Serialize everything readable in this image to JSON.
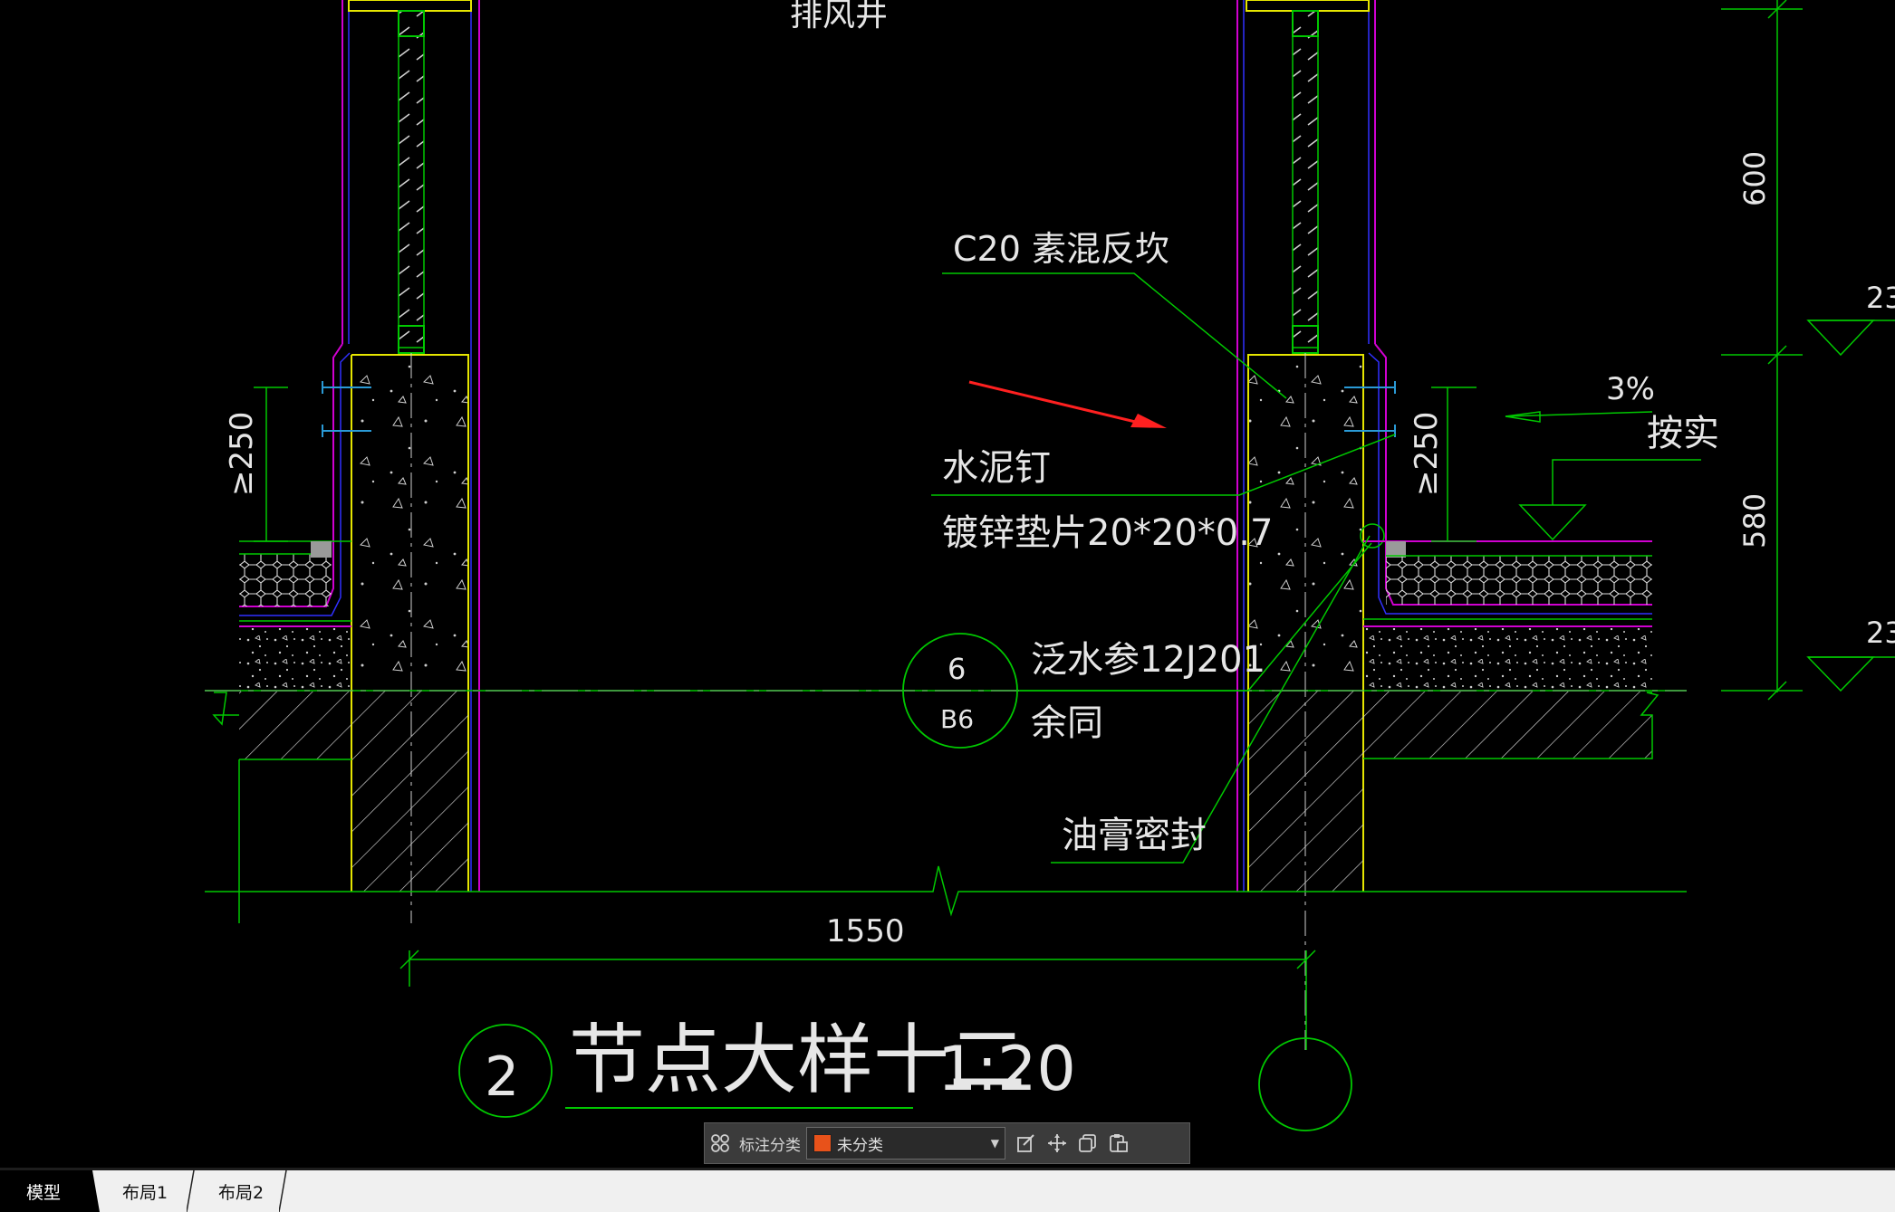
{
  "drawing": {
    "title_top": "排风井",
    "dim_600": "600",
    "dim_580": "580",
    "elev_mark_top": "23",
    "elev_mark_bottom": "23",
    "dim_250_left": "≥250",
    "dim_250_right": "≥250",
    "slope": "3%",
    "slope_note": "按实",
    "label_c20": "C20  素混反坎",
    "label_nail": "水泥钉",
    "label_washer": "镀锌垫片20*20*0.7",
    "label_flashing": "泛水参12J201",
    "label_same": "余同",
    "label_seal": "油膏密封",
    "bubble_top": "6",
    "bubble_bottom": "B6",
    "dim_1550": "1550",
    "detail_number": "2",
    "detail_title": "节点大样十二",
    "detail_scale": "1:20"
  },
  "annotation_toolbar": {
    "category_label": "标注分类",
    "category_value": "未分类",
    "swatch_color": "#e8521a",
    "icons": [
      "grid-icon",
      "edit-icon",
      "move-icon",
      "copy-icon",
      "paste-icon"
    ]
  },
  "tabs": [
    "模型",
    "布局1",
    "布局2"
  ],
  "colors": {
    "green": "#00c800",
    "yellow": "#e6e600",
    "magenta": "#d000d0",
    "blue": "#3030ff",
    "red_arrow": "#ff2020"
  }
}
